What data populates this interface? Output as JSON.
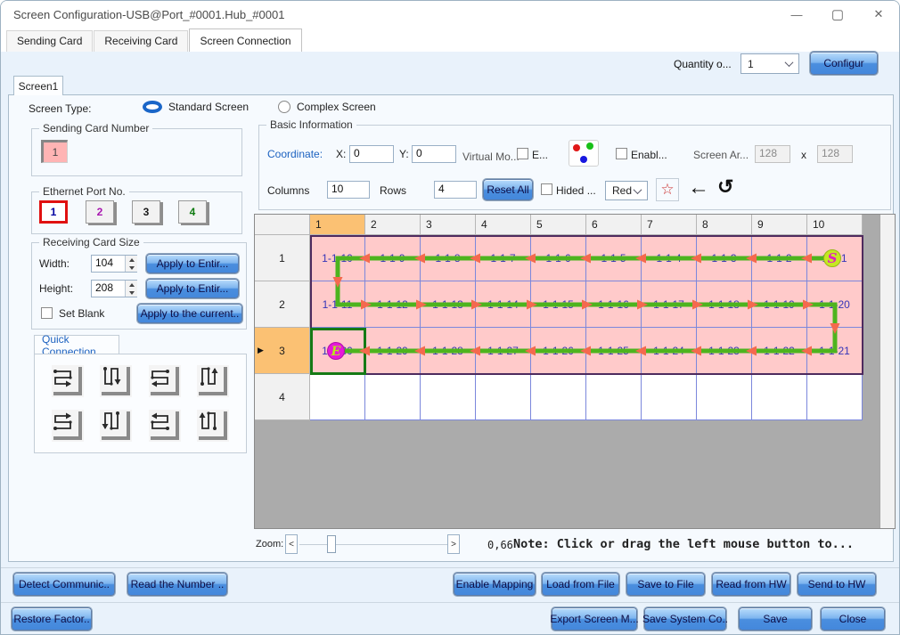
{
  "window": {
    "title": "Screen Configuration-USB@Port_#0001.Hub_#0001"
  },
  "icons": {
    "minimize": "—",
    "maximize": "▢",
    "close": "✕",
    "star": "☆",
    "back_arrow": "←",
    "undo": "↺",
    "row_marker": "▶"
  },
  "tabs": [
    "Sending Card",
    "Receiving Card",
    "Screen Connection"
  ],
  "header": {
    "quantity_label": "Quantity o...",
    "quantity_value": "1",
    "configure_button": "Configur"
  },
  "screen_tab": "Screen1",
  "screen_type": {
    "label": "Screen Type:",
    "options": [
      {
        "label": "Standard Screen",
        "selected": true
      },
      {
        "label": "Complex Screen",
        "selected": false
      }
    ]
  },
  "sending_card": {
    "title": "Sending Card Number",
    "card_number": "1"
  },
  "ethernet_port": {
    "title": "Ethernet Port No.",
    "ports": [
      {
        "label": "1",
        "color": "#0000a0",
        "selected": true
      },
      {
        "label": "2",
        "color": "#a818b0",
        "selected": false
      },
      {
        "label": "3",
        "color": "#1a1a1a",
        "selected": false
      },
      {
        "label": "4",
        "color": "#0e7a10",
        "selected": false
      }
    ]
  },
  "receiving_card_size": {
    "title": "Receiving Card Size",
    "width_label": "Width:",
    "width_value": "104",
    "apply_width_button": "Apply to Entir...",
    "height_label": "Height:",
    "height_value": "208",
    "apply_height_button": "Apply to Entir...",
    "set_blank_label": "Set Blank",
    "apply_current_button": "Apply to the current.."
  },
  "quick_connection": {
    "title": "Quick Connection",
    "patterns": [
      "serpentine-right-from-top-left",
      "serpentine-down-from-top-left",
      "serpentine-left-from-top-right",
      "serpentine-up-from-bottom-left",
      "serpentine-right-from-bottom-left",
      "serpentine-down-from-top-right",
      "serpentine-left-from-bottom-right",
      "serpentine-up-from-bottom-right"
    ]
  },
  "basic_information": {
    "title": "Basic Information",
    "coordinate_label": "Coordinate:",
    "x_label": "X:",
    "x_value": "0",
    "y_label": "Y:",
    "y_value": "0",
    "virtual_mode_label": "Virtual Mo...",
    "virtual_enable_label": "E...",
    "rgb_enable_label": "Enabl...",
    "screen_area_label": "Screen Ar...",
    "screen_area_width": "128",
    "separator": "x",
    "screen_area_height": "128",
    "columns_label": "Columns",
    "columns_value": "10",
    "rows_label": "Rows",
    "rows_value": "4",
    "reset_all_button": "Reset All",
    "hided_label": "Hided ...",
    "color_value": "Red"
  },
  "grid": {
    "column_headers": [
      "1",
      "2",
      "3",
      "4",
      "5",
      "6",
      "7",
      "8",
      "9",
      "10"
    ],
    "row_headers": [
      "1",
      "2",
      "3",
      "4"
    ],
    "active_column_index": 0,
    "active_row_index": 2,
    "cells": [
      [
        "1-1-10",
        "1-1-9",
        "1-1-8",
        "1-1-7",
        "1-1-6",
        "1-1-5",
        "1-1-4",
        "1-1-3",
        "1-1-2",
        "1-1-1"
      ],
      [
        "1-1-11",
        "1-1-12",
        "1-1-13",
        "1-1-14",
        "1-1-15",
        "1-1-16",
        "1-1-17",
        "1-1-18",
        "1-1-19",
        "1-1-20"
      ],
      [
        "1-1-30",
        "1-1-29",
        "1-1-28",
        "1-1-27",
        "1-1-26",
        "1-1-25",
        "1-1-24",
        "1-1-23",
        "1-1-22",
        "1-1-21"
      ],
      [
        "",
        "",
        "",
        "",
        "",
        "",
        "",
        "",
        "",
        ""
      ]
    ],
    "start_marker": "S",
    "end_marker": "E"
  },
  "zoom_bar": {
    "label": "Zoom:",
    "out_button": "<",
    "in_button": ">",
    "value": "0,66",
    "note": "Note: Click or drag the left mouse button to..."
  },
  "footer": {
    "detect": "Detect Communic..",
    "read_number": "Read the Number ..",
    "enable_mapping": "Enable Mapping",
    "load_from_file": "Load from File",
    "save_to_file": "Save to File",
    "read_from_hw": "Read from HW",
    "send_to_hw": "Send to HW",
    "restore_factory": "Restore Factor..",
    "export_screen": "Export Screen M...",
    "save_system": "Save System Co..",
    "save": "Save",
    "close": "Close"
  },
  "colors": {
    "cell_pink": "#ffcaca",
    "grid_blue": "#7b87dc",
    "path_green": "#4db41e",
    "arrow_orange": "#f4694e",
    "header_orange": "#fbc173",
    "selection_green": "#157a15",
    "region_purple": "#4e2a5e",
    "start_marker_fill": "#c6e822",
    "start_marker_text": "#e020c0",
    "end_marker_fill": "#e818d8",
    "end_marker_text": "#b8e818"
  }
}
